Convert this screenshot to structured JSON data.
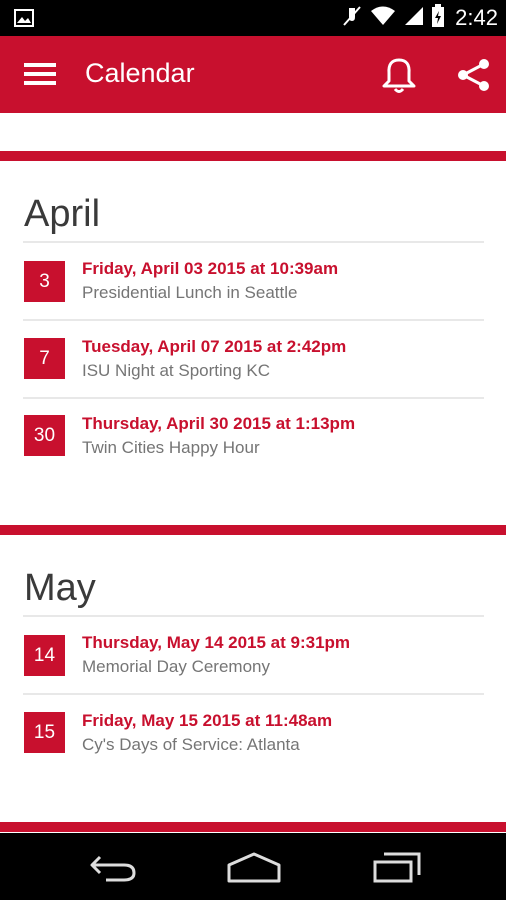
{
  "status_bar": {
    "time": "2:42",
    "icons": [
      "image-icon",
      "mute-icon",
      "wifi-icon",
      "signal-icon",
      "battery-icon"
    ]
  },
  "app_bar": {
    "title": "Calendar",
    "icons": [
      "menu-icon",
      "bell-icon",
      "share-icon"
    ],
    "color": "#c8102e"
  },
  "months": [
    {
      "name": "April",
      "events": [
        {
          "day": "3",
          "datetime": "Friday, April 03 2015 at 10:39am",
          "title": "Presidential Lunch in Seattle"
        },
        {
          "day": "7",
          "datetime": "Tuesday, April 07 2015 at 2:42pm",
          "title": "ISU Night at Sporting KC"
        },
        {
          "day": "30",
          "datetime": "Thursday, April 30 2015 at 1:13pm",
          "title": "Twin Cities Happy Hour"
        }
      ]
    },
    {
      "name": "May",
      "events": [
        {
          "day": "14",
          "datetime": "Thursday, May 14 2015 at 9:31pm",
          "title": "Memorial Day Ceremony"
        },
        {
          "day": "15",
          "datetime": "Friday, May 15 2015 at 11:48am",
          "title": "Cy's Days of Service: Atlanta"
        }
      ]
    }
  ],
  "nav_bar": {
    "icons": [
      "back-icon",
      "home-icon",
      "recent-apps-icon"
    ]
  }
}
